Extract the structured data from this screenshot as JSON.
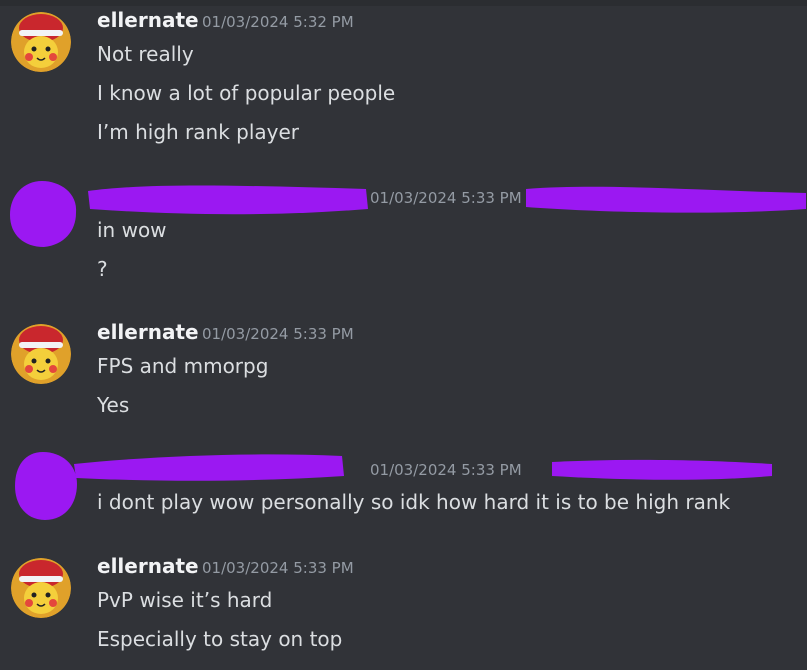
{
  "groups": [
    {
      "username": "ellernate",
      "timestamp": "01/03/2024 5:32 PM",
      "messages": [
        "Not really",
        "I know a lot of popular people",
        "I’m high rank player"
      ]
    },
    {
      "username": "",
      "timestamp": "01/03/2024 5:33 PM",
      "messages": [
        "in wow",
        "?"
      ]
    },
    {
      "username": "ellernate",
      "timestamp": "01/03/2024 5:33 PM",
      "messages": [
        "FPS and mmorpg",
        "Yes"
      ]
    },
    {
      "username": "",
      "timestamp": "01/03/2024 5:33 PM",
      "messages": [
        "i dont play wow personally so idk how hard it is to be high rank"
      ]
    },
    {
      "username": "ellernate",
      "timestamp": "01/03/2024 5:33 PM",
      "messages": [
        "PvP wise it’s hard",
        "Especially to stay on top"
      ]
    }
  ],
  "colors": {
    "background": "#313338",
    "redaction": "#9b18f2",
    "username": "#f2f3f5",
    "timestamp": "#949ba4",
    "message": "#dbdee1"
  },
  "icons": {
    "ellernate_avatar": "pikachu-cap-avatar-icon",
    "redacted_avatar": "redacted-avatar-icon"
  }
}
